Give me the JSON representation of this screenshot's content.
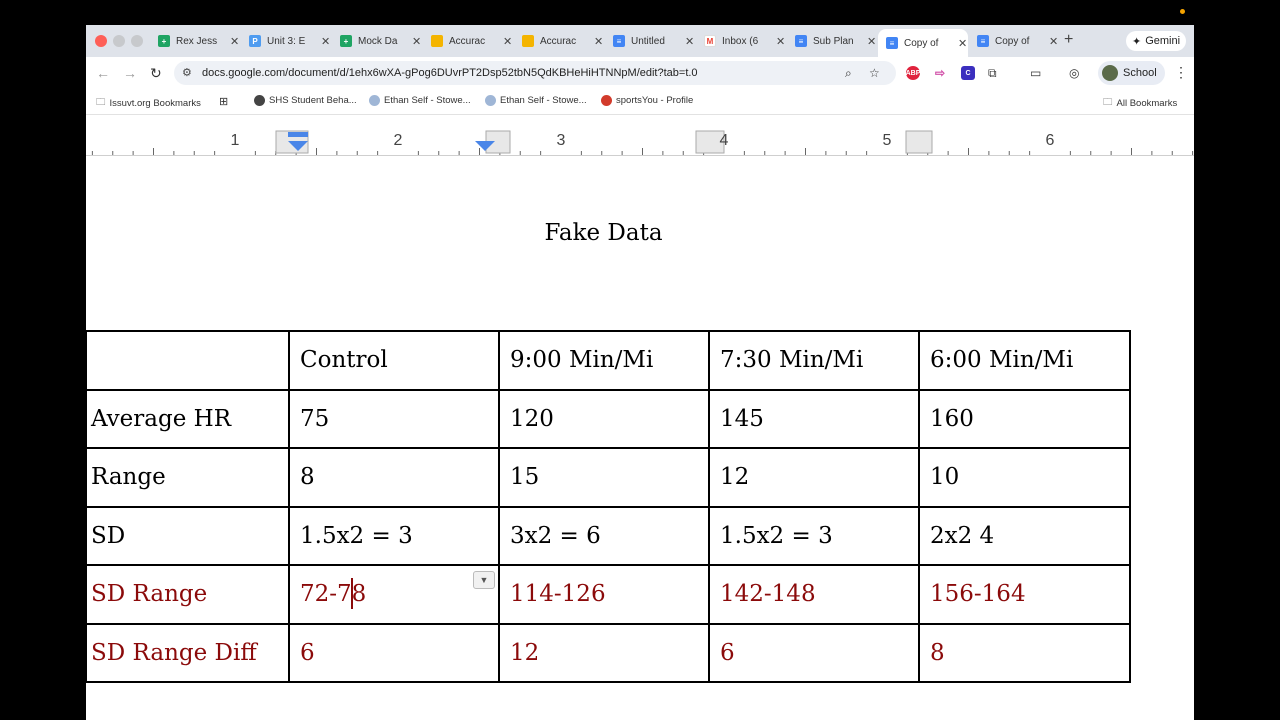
{
  "browser": {
    "tabs": [
      {
        "label": "Rex Jess",
        "icon": "sheets-icon",
        "color": "#1fa463"
      },
      {
        "label": "Unit 3: E",
        "icon": "pear-icon",
        "color": "#4f9cf0"
      },
      {
        "label": "Mock Da",
        "icon": "sheets-icon",
        "color": "#1fa463"
      },
      {
        "label": "Accurac",
        "icon": "slides-icon",
        "color": "#f4b400"
      },
      {
        "label": "Accurac",
        "icon": "slides-icon",
        "color": "#f4b400"
      },
      {
        "label": "Untitled",
        "icon": "docs-icon",
        "color": "#4285f4"
      },
      {
        "label": "Inbox (6",
        "icon": "gmail-icon",
        "color": "#ea4335"
      },
      {
        "label": "Sub Plan",
        "icon": "docs-icon",
        "color": "#4285f4"
      },
      {
        "label": "Copy of",
        "icon": "docs-icon",
        "color": "#4285f4"
      },
      {
        "label": "Copy of",
        "icon": "docs-icon",
        "color": "#4285f4"
      }
    ],
    "new_tab": "+",
    "gemini_label": "Gemini",
    "url": "docs.google.com/document/d/1ehx6wXA-gPog6DUvrPT2Dsp52tbN5QdKBHeHiHTNNpM/edit?tab=t.0",
    "profile_label": "School",
    "extensions": [
      {
        "label": "ABP",
        "color": "#e0233d"
      },
      {
        "label": "",
        "color": "#d14fa8"
      },
      {
        "label": "C",
        "color": "#3b2fbf"
      }
    ]
  },
  "bookmarks": {
    "items": [
      "Issuvt.org Bookmarks",
      "",
      "SHS Student Beha...",
      "Ethan Self - Stowe...",
      "Ethan Self - Stowe...",
      "sportsYou - Profile"
    ],
    "all_bookmarks": "All Bookmarks"
  },
  "ruler": {
    "numbers": [
      "1",
      "2",
      "3",
      "4",
      "5",
      "6"
    ]
  },
  "document": {
    "title": "Fake Data",
    "table": {
      "header": [
        "",
        "Control",
        "9:00 Min/Mi",
        "7:30 Min/Mi",
        "6:00 Min/Mi"
      ],
      "rows": [
        {
          "label": "Average HR",
          "values": [
            "75",
            "120",
            "145",
            "160"
          ],
          "style": "normal"
        },
        {
          "label": "Range",
          "values": [
            "8",
            "15",
            "12",
            "10"
          ],
          "style": "normal"
        },
        {
          "label": "SD",
          "values": [
            "1.5x2 = 3",
            "3x2 = 6",
            "1.5x2 = 3",
            "2x2 4"
          ],
          "style": "normal"
        },
        {
          "label": "SD Range",
          "values": [
            "72-78",
            "114-126",
            "142-148",
            "156-164"
          ],
          "style": "red"
        },
        {
          "label": "SD Range Diff",
          "values": [
            "6",
            "12",
            "6",
            "8"
          ],
          "style": "red"
        }
      ],
      "accent_color": "#8b0a0a"
    }
  }
}
